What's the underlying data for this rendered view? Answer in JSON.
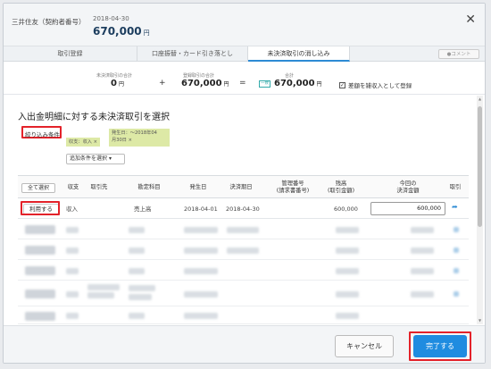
{
  "header": {
    "account_name": "三井住友（契約者番号）",
    "date": "2018-04-30",
    "amount": "670,000",
    "amount_unit": "円"
  },
  "tabs": [
    {
      "label": "取引登録"
    },
    {
      "label": "口座振替・カード引き落とし"
    },
    {
      "label": "未決済取引の消し込み"
    }
  ],
  "comment_label": "コメント",
  "summary": {
    "unsettled_label": "未決済取引の合計",
    "unsettled_value": "0",
    "plus": "+",
    "registered_label": "登録取引の合計",
    "registered_value": "670,000",
    "equals": "=",
    "total_label": "合計",
    "total_tag": "一致",
    "total_value": "670,000",
    "yen": "円",
    "difference_checkbox_label": "差額を雑収入として登録"
  },
  "section_title": "入出金明細に対する未決済取引を選択",
  "filter": {
    "label": "絞り込み条件",
    "chip_income": "収支：収入 ×",
    "chip_date_line1": "発生日：～2018年04",
    "chip_date_line2": "月30日 ×",
    "add_condition": "追加条件を選択"
  },
  "table": {
    "select_all": "全て選択",
    "headers": [
      "収支",
      "取引先",
      "勘定科目",
      "発生日",
      "決済期日",
      "管理番号",
      "(請求書番号)",
      "残高",
      "(取引金額)",
      "今回の",
      "決済金額",
      "取引"
    ],
    "row": {
      "use_label": "利用する",
      "kind": "収入",
      "partner": "",
      "account": "売上高",
      "occurred": "2018-04-01",
      "due": "2018-04-30",
      "balance": "600,000",
      "settle_amount": "600,000"
    }
  },
  "footer": {
    "cancel": "キャンセル",
    "done": "完了する"
  },
  "colors": {
    "accent": "#1f8ce0",
    "highlight_red": "#e3222a",
    "chip": "#dde9a6"
  }
}
